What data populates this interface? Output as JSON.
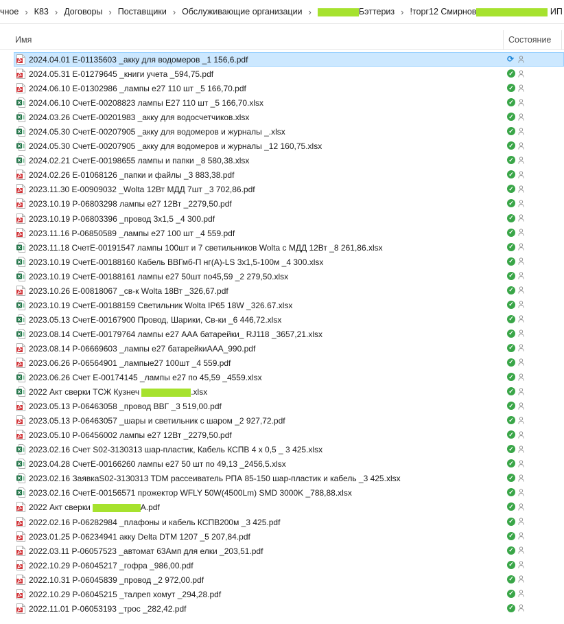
{
  "breadcrumb": {
    "items": [
      "чное",
      "К83",
      "Договоры",
      "Поставщики",
      "Обслуживающие организации",
      "Бэттериз",
      "!торг12 Смирнов",
      "ИП"
    ]
  },
  "columns": {
    "name": "Имя",
    "status": "Состояние"
  },
  "colors": {
    "selected_bg": "#cce8ff",
    "status_ok": "#3aa648",
    "sync": "#1f86d8",
    "pdf": "#d13438",
    "xlsx": "#1e7145",
    "redaction": "#a6e22e"
  },
  "files": [
    {
      "name": "2024.04.01 Е-01135603 _акку для водомеров _1 156,6.pdf",
      "type": "pdf",
      "status": "sync",
      "selected": true
    },
    {
      "name": "2024.05.31 Е-01279645 _книги учета _594,75.pdf",
      "type": "pdf",
      "status": "ok"
    },
    {
      "name": "2024.06.10 Е-01302986 _лампы е27 110 шт _5 166,70.pdf",
      "type": "pdf",
      "status": "ok"
    },
    {
      "name": "2024.06.10 СчетЕ-00208823 лампы Е27 110 шт _5 166,70.xlsx",
      "type": "xlsx",
      "status": "ok"
    },
    {
      "name": "2024.03.26 СчетЕ-00201983 _акку для водосчетчиков.xlsx",
      "type": "xlsx",
      "status": "ok"
    },
    {
      "name": "2024.05.30 СчетЕ-00207905 _акку для водомеров и журналы _.xlsx",
      "type": "xlsx",
      "status": "ok"
    },
    {
      "name": "2024.05.30 СчетЕ-00207905 _акку для водомеров и журналы _12 160,75.xlsx",
      "type": "xlsx",
      "status": "ok"
    },
    {
      "name": "2024.02.21 СчетЕ-00198655 лампы и папки _8 580,38.xlsx",
      "type": "xlsx",
      "status": "ok"
    },
    {
      "name": "2024.02.26 Е-01068126 _папки и файлы _3 883,38.pdf",
      "type": "pdf",
      "status": "ok"
    },
    {
      "name": "2023.11.30 Е-00909032 _Wolta 12Вт МДД 7шт _3 702,86.pdf",
      "type": "pdf",
      "status": "ok"
    },
    {
      "name": "2023.10.19 Р-06803298 лампы е27 12Вт _2279,50.pdf",
      "type": "pdf",
      "status": "ok"
    },
    {
      "name": "2023.10.19 Р-06803396 _провод 3х1,5 _4 300.pdf",
      "type": "pdf",
      "status": "ok"
    },
    {
      "name": "2023.11.16 Р-06850589 _лампы е27 100 шт _4 559.pdf",
      "type": "pdf",
      "status": "ok"
    },
    {
      "name": "2023.11.18 СчетЕ-00191547 лампы 100шт и 7 светильников Wolta с МДД 12Вт _8 261,86.xlsx",
      "type": "xlsx",
      "status": "ok"
    },
    {
      "name": "2023.10.19 СчетЕ-00188160 Кабель ВВГмб-П нг(А)-LS 3х1,5-100м _4 300.xlsx",
      "type": "xlsx",
      "status": "ok"
    },
    {
      "name": "2023.10.19 СчетЕ-00188161 лампы е27 50шт по45,59 _2 279,50.xlsx",
      "type": "xlsx",
      "status": "ok"
    },
    {
      "name": "2023.10.26 Е-00818067 _св-к Wolta 18Вт _326,67.pdf",
      "type": "pdf",
      "status": "ok"
    },
    {
      "name": "2023.10.19 СчетЕ-00188159 Светильник Wolta IP65 18W _326.67.xlsx",
      "type": "xlsx",
      "status": "ok"
    },
    {
      "name": "2023.05.13 СчетЕ-00167900 Провод, Шарики, Св-ки _6 446,72.xlsx",
      "type": "xlsx",
      "status": "ok"
    },
    {
      "name": "2023.08.14 СчетЕ-00179764 лампы е27 ААА батарейки_ RJ118 _3657,21.xlsx",
      "type": "xlsx",
      "status": "ok"
    },
    {
      "name": "2023.08.14 Р-06669603 _лампы е27 батарейкиААА_990.pdf",
      "type": "pdf",
      "status": "ok"
    },
    {
      "name": "2023.06.26 Р-06564901 _лампые27 100шт _4 559.pdf",
      "type": "pdf",
      "status": "ok"
    },
    {
      "name": "2023.06.26 Счет Е-00174145 _лампы е27 по 45,59 _4559.xlsx",
      "type": "xlsx",
      "status": "ok"
    },
    {
      "name_pre": "2022 Акт сверки ТСЖ Кузнеч",
      "name_post": ".xlsx",
      "type": "xlsx",
      "status": "ok",
      "redacted": true
    },
    {
      "name": "2023.05.13 Р-06463058 _провод ВВГ _3 519,00.pdf",
      "type": "pdf",
      "status": "ok"
    },
    {
      "name": "2023.05.13 Р-06463057 _шары и светильник с шаром _2 927,72.pdf",
      "type": "pdf",
      "status": "ok"
    },
    {
      "name": "2023.05.10 Р-06456002 лампы е27 12Вт _2279,50.pdf",
      "type": "pdf",
      "status": "ok"
    },
    {
      "name": "2023.02.16 Счет S02-3130313 шар-пластик, Кабель КСПВ 4 х 0,5 _ 3 425.xlsx",
      "type": "xlsx",
      "status": "ok"
    },
    {
      "name": "2023.04.28 СчетЕ-00166260 лампы е27 50 шт по 49,13 _2456,5.xlsx",
      "type": "xlsx",
      "status": "ok"
    },
    {
      "name": "2023.02.16 ЗаявкаS02-3130313 TDM рассеиватель РПА 85-150 шар-пластик и кабель _3 425.xlsx",
      "type": "xlsx",
      "status": "ok"
    },
    {
      "name": "2023.02.16 СчетЕ-00156571 прожектор WFLY 50W(4500Lm) SMD 3000K _788,88.xlsx",
      "type": "xlsx",
      "status": "ok"
    },
    {
      "name_pre": "2022 Акт сверки",
      "name_post": "А.pdf",
      "type": "pdf",
      "status": "ok",
      "redacted": true
    },
    {
      "name": "2022.02.16 Р-06282984 _плафоны и кабель КСПВ200м _3 425.pdf",
      "type": "pdf",
      "status": "ok"
    },
    {
      "name": "2023.01.25 Р-06234941 акку Delta DTM 1207 _5 207,84.pdf",
      "type": "pdf",
      "status": "ok"
    },
    {
      "name": "2022.03.11 Р-06057523 _автомат 63Амп для елки _203,51.pdf",
      "type": "pdf",
      "status": "ok"
    },
    {
      "name": "2022.10.29 Р-06045217 _гофра _986,00.pdf",
      "type": "pdf",
      "status": "ok"
    },
    {
      "name": "2022.10.31 Р-06045839 _провод _2 972,00.pdf",
      "type": "pdf",
      "status": "ok"
    },
    {
      "name": "2022.10.29 Р-06045215 _талреп хомут _294,28.pdf",
      "type": "pdf",
      "status": "ok"
    },
    {
      "name": "2022.11.01 Р-06053193 _трос _282,42.pdf",
      "type": "pdf",
      "status": "ok"
    }
  ]
}
